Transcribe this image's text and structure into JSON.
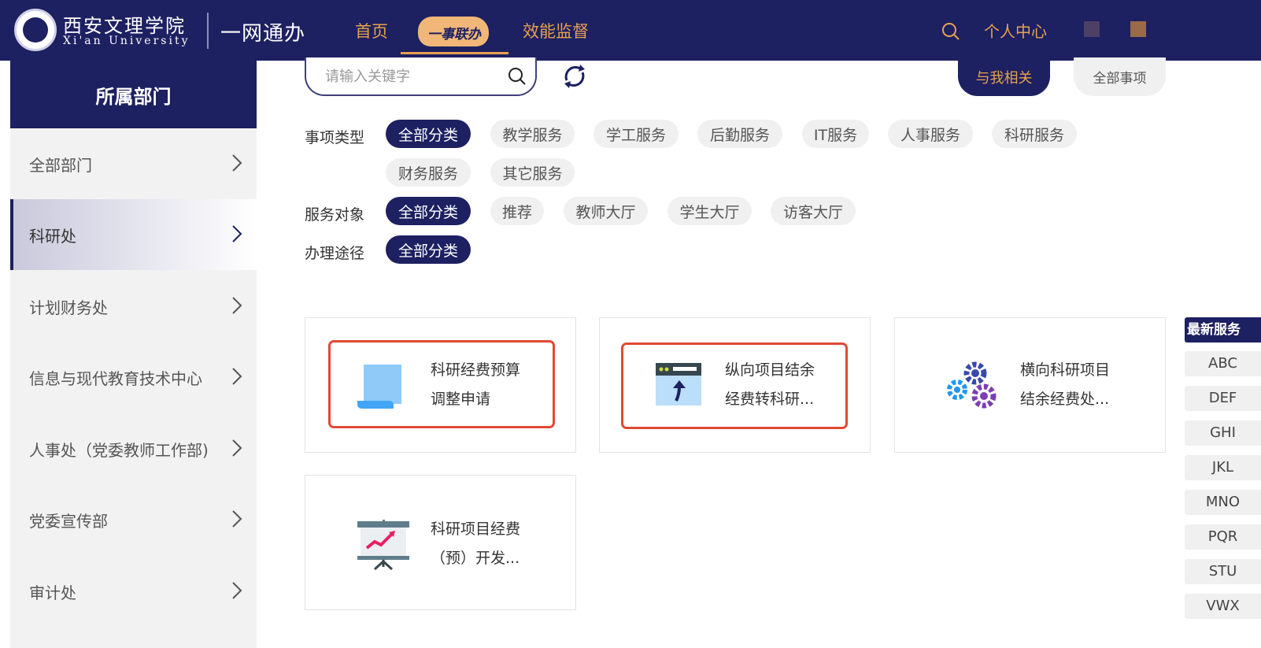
{
  "header": {
    "school_cn": "西安文理学院",
    "school_en": "Xi'an University",
    "app_name": "一网通办",
    "nav": {
      "home": "首页",
      "one_event": "一事联办",
      "monitor": "效能监督"
    },
    "personal_center": "个人中心"
  },
  "sidebar": {
    "title": "所属部门",
    "items": [
      {
        "label": "全部部门"
      },
      {
        "label": "科研处"
      },
      {
        "label": "计划财务处"
      },
      {
        "label": "信息与现代教育技术中心"
      },
      {
        "label": "人事处（党委教师工作部)"
      },
      {
        "label": "党委宣传部"
      },
      {
        "label": "审计处"
      }
    ],
    "active_index": 1
  },
  "search": {
    "placeholder": "请输入关键字",
    "value": ""
  },
  "scope": {
    "related": "与我相关",
    "all": "全部事项"
  },
  "filters": {
    "type": {
      "label": "事项类型",
      "options": [
        "全部分类",
        "教学服务",
        "学工服务",
        "后勤服务",
        "IT服务",
        "人事服务",
        "科研服务",
        "财务服务",
        "其它服务"
      ],
      "selected": "全部分类"
    },
    "target": {
      "label": "服务对象",
      "options": [
        "全部分类",
        "推荐",
        "教师大厅",
        "学生大厅",
        "访客大厅"
      ],
      "selected": "全部分类"
    },
    "channel": {
      "label": "办理途径",
      "options": [
        "全部分类"
      ],
      "selected": "全部分类"
    }
  },
  "services": [
    {
      "line1": "科研经费预算",
      "line2": "调整申请",
      "icon": "document-scroll-icon",
      "highlighted": true
    },
    {
      "line1": "纵向项目结余",
      "line2": "经费转科研...",
      "icon": "browser-upload-icon",
      "highlighted": true
    },
    {
      "line1": "横向科研项目",
      "line2": "结余经费处...",
      "icon": "gears-icon",
      "highlighted": false
    },
    {
      "line1": "科研项目经费",
      "line2": "（预）开发...",
      "icon": "presentation-chart-icon",
      "highlighted": false
    }
  ],
  "letter_index": {
    "title": "最新服务",
    "items": [
      "ABC",
      "DEF",
      "GHI",
      "JKL",
      "MNO",
      "PQR",
      "STU",
      "VWX"
    ]
  },
  "colors": {
    "primary": "#1d2061",
    "accent": "#e7a24f",
    "highlight": "#e04a33"
  }
}
